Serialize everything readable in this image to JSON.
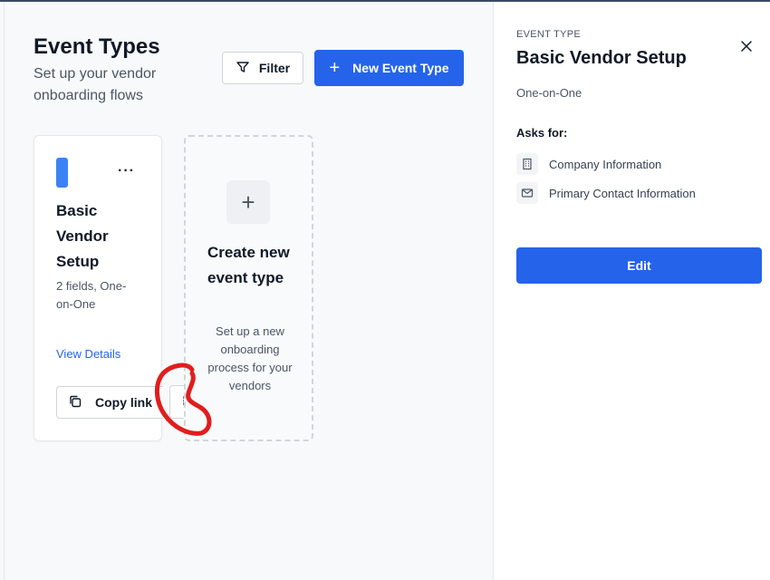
{
  "header": {
    "title": "Event Types",
    "subtitle": "Set up your vendor onboarding flows",
    "filter_label": "Filter",
    "new_label": "New Event Type"
  },
  "cards": [
    {
      "title": "Basic Vendor Setup",
      "meta": "2 fields, One-on-One",
      "view_label": "View Details",
      "copy_label": "Copy link",
      "accent_color": "#3b82f6"
    }
  ],
  "create_card": {
    "title": "Create new event type",
    "description": "Set up a new onboarding process for your vendors"
  },
  "panel": {
    "eyebrow": "EVENT TYPE",
    "title": "Basic Vendor Setup",
    "subtitle": "One-on-One",
    "asks_label": "Asks for:",
    "fields": [
      {
        "label": "Company Information",
        "icon": "building-icon"
      },
      {
        "label": "Primary Contact Information",
        "icon": "mail-icon"
      }
    ],
    "edit_label": "Edit"
  },
  "colors": {
    "primary": "#2563eb",
    "annotation": "#e11d1d"
  }
}
